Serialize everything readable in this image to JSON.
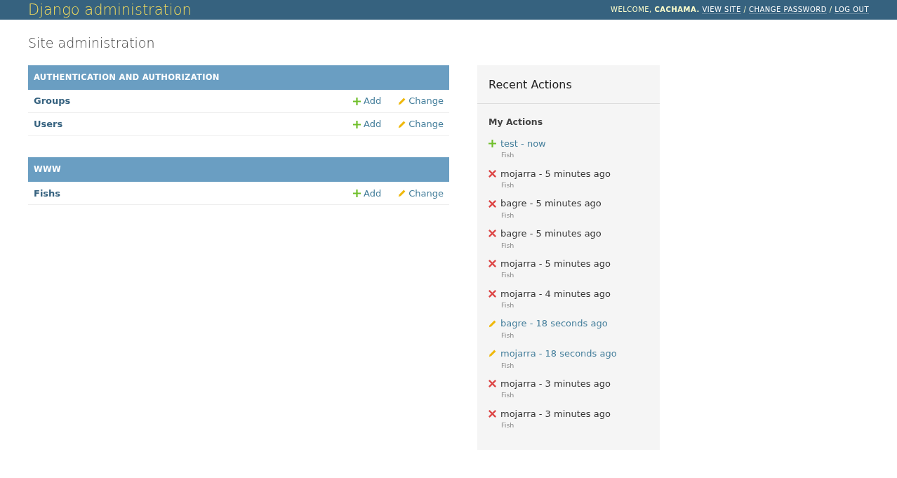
{
  "header": {
    "branding": "Django administration",
    "user_tools": {
      "welcome": "WELCOME,",
      "username": "CACHAMA.",
      "separator": "/",
      "links": [
        "VIEW SITE",
        "CHANGE PASSWORD",
        "LOG OUT"
      ]
    }
  },
  "title": "Site administration",
  "apps": [
    {
      "name": "AUTHENTICATION AND AUTHORIZATION",
      "models": [
        {
          "name": "Groups",
          "add": "Add",
          "change": "Change"
        },
        {
          "name": "Users",
          "add": "Add",
          "change": "Change"
        }
      ]
    },
    {
      "name": "WWW",
      "models": [
        {
          "name": "Fishs",
          "add": "Add",
          "change": "Change"
        }
      ]
    }
  ],
  "recent_actions": {
    "title": "Recent Actions",
    "subtitle": "My Actions",
    "items": [
      {
        "kind": "addition",
        "label": "test - now",
        "type": "Fish"
      },
      {
        "kind": "deletion",
        "label": "mojarra - 5 minutes ago",
        "type": "Fish"
      },
      {
        "kind": "deletion",
        "label": "bagre - 5 minutes ago",
        "type": "Fish"
      },
      {
        "kind": "deletion",
        "label": "bagre - 5 minutes ago",
        "type": "Fish"
      },
      {
        "kind": "deletion",
        "label": "mojarra - 5 minutes ago",
        "type": "Fish"
      },
      {
        "kind": "deletion",
        "label": "mojarra - 4 minutes ago",
        "type": "Fish"
      },
      {
        "kind": "change",
        "label": "bagre - 18 seconds ago",
        "type": "Fish"
      },
      {
        "kind": "change",
        "label": "mojarra - 18 seconds ago",
        "type": "Fish"
      },
      {
        "kind": "deletion",
        "label": "mojarra - 3 minutes ago",
        "type": "Fish"
      },
      {
        "kind": "deletion",
        "label": "mojarra - 3 minutes ago",
        "type": "Fish"
      }
    ]
  }
}
